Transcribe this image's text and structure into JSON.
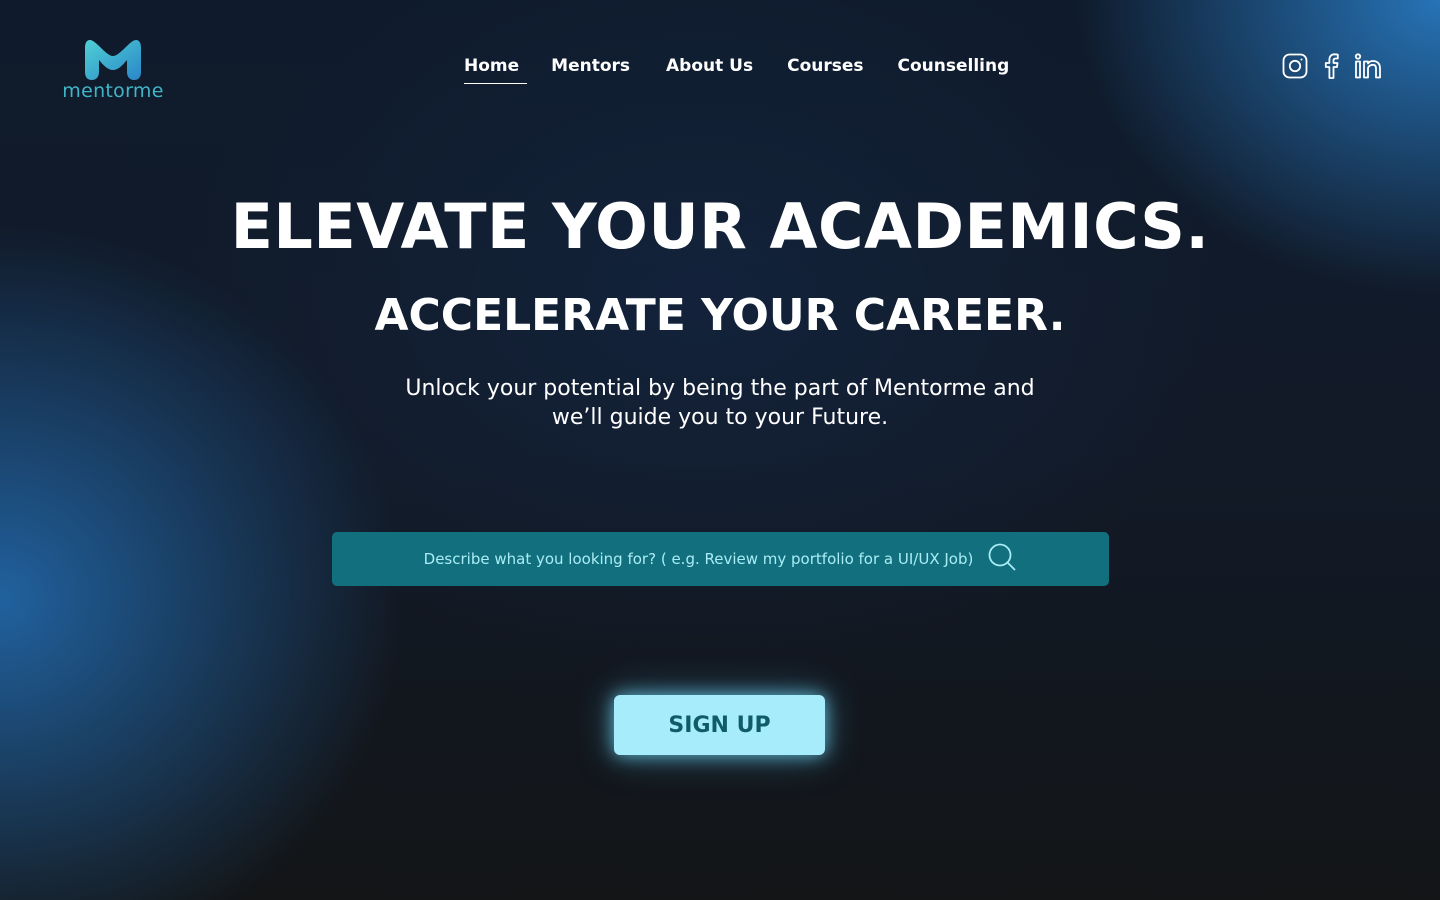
{
  "brand": {
    "name": "mentorme",
    "logo_icon": "m-logo-icon",
    "color": "#3fb6c8"
  },
  "nav": {
    "items": [
      {
        "label": "Home",
        "active": true
      },
      {
        "label": "Mentors",
        "active": false
      },
      {
        "label": "About Us",
        "active": false
      },
      {
        "label": "Courses",
        "active": false
      },
      {
        "label": "Counselling",
        "active": false
      }
    ]
  },
  "social": [
    "instagram-icon",
    "facebook-icon",
    "linkedin-icon"
  ],
  "hero": {
    "headline": "ELEVATE YOUR ACADEMICS.",
    "subheadline": "ACCELERATE YOUR CAREER.",
    "description_line1": "Unlock your potential by being the part of Mentorme and",
    "description_line2": "we’ll guide you to your Future."
  },
  "search": {
    "placeholder": "Describe what you looking for? ( e.g. Review my portfolio for a UI/UX Job)",
    "icon": "search-icon",
    "background": "#12707e"
  },
  "cta": {
    "signup_label": "SIGN UP",
    "background": "#a6ecfb",
    "text_color": "#0f5b68"
  }
}
